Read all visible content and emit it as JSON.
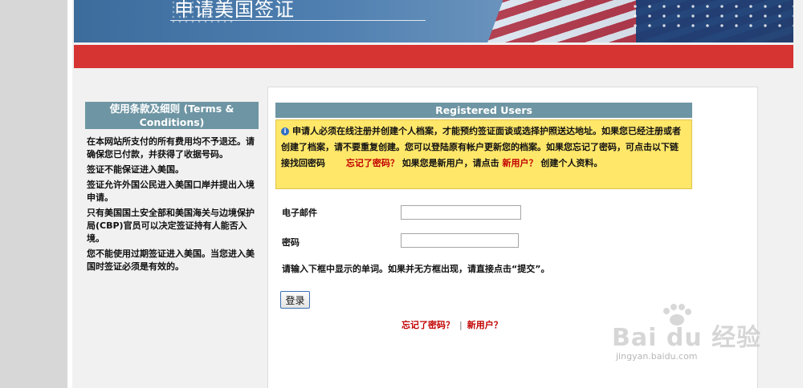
{
  "header": {
    "title": "申请美国签证"
  },
  "sidebar": {
    "title": "使用条款及细则 (Terms & Conditions)",
    "paragraphs": [
      "在本网站所支付的所有费用均不予退还。请确保您已付款，并获得了收据号码。",
      "签证不能保证进入美国。",
      "签证允许外国公民进入美国口岸并提出入境申请。",
      "只有美国国土安全部和美国海关与边境保护局(CBP)官员可以决定签证持有人能否入境。",
      "您不能使用过期签证进入美国。当您进入美国时签证必须是有效的。"
    ]
  },
  "registered": {
    "title": "Registered Users",
    "notice_text_1": "申请人必须在线注册并创建个人档案，才能预约签证面谈或选择护照送达地址。如果您已经注册或者创建了档案，请不要重复创建。您可以登陆原有帐户更新您的档案。如果您忘记了密码，可点击以下链接找回密码",
    "forgot_link": "忘记了密码？",
    "notice_text_2": "如果您是新用户，请点击",
    "new_user_link": "新用户？",
    "notice_text_3": "创建个人资料。"
  },
  "form": {
    "email_label": "电子邮件",
    "email_value": "",
    "password_label": "密码",
    "password_value": "",
    "instruction": "请输入下框中显示的单词。如果并无方框出现，请直接点击“提交”。",
    "login_button": "登录"
  },
  "bottom_links": {
    "forgot": "忘记了密码？",
    "separator": "|",
    "new_user": "新用户？"
  },
  "watermark": {
    "brand": "Bai du 经验",
    "url": "jingyan.baidu.com"
  },
  "colors": {
    "section_header": "#6e95a3",
    "notice_bg": "#ffe76a",
    "red_bar": "#d63333",
    "link_red": "#c20000"
  }
}
